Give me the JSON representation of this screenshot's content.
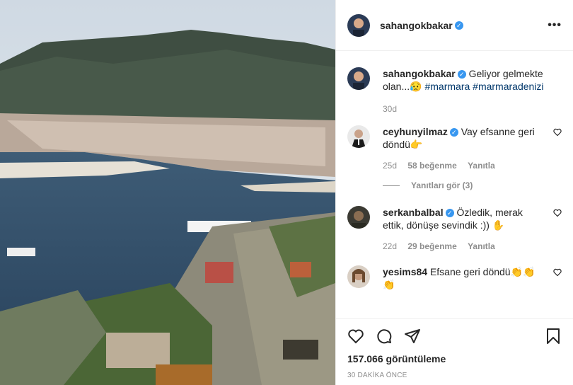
{
  "post": {
    "author": "sahangokbakar",
    "more_label": "•••"
  },
  "caption": {
    "user": "sahangokbakar",
    "text": "Geliyor gelmekte olan...😥",
    "hashtags": [
      "#marmara",
      "#marmaradenizi"
    ],
    "age": "30d"
  },
  "comments": [
    {
      "user": "ceyhunyilmaz",
      "verified": true,
      "text": "Vay efsanne geri döndü👉",
      "age": "25d",
      "likes": "58 beğenme",
      "reply": "Yanıtla"
    },
    {
      "user": "serkanbalbal",
      "verified": true,
      "text": "Özledik, merak ettik, dönüşe sevindik :)) ✋",
      "age": "22d",
      "likes": "29 beğenme",
      "reply": "Yanıtla"
    },
    {
      "user": "yesims84",
      "verified": false,
      "text": "Efsane geri döndü👏👏👏"
    }
  ],
  "view_replies": "Yanıtları gör (3)",
  "stats": {
    "views": "157.066 görüntüleme",
    "timestamp": "30 DAKİKA ÖNCE"
  },
  "icons": [
    "heart-icon",
    "comment-icon",
    "share-icon",
    "bookmark-icon",
    "verified-icon",
    "more-icon"
  ]
}
